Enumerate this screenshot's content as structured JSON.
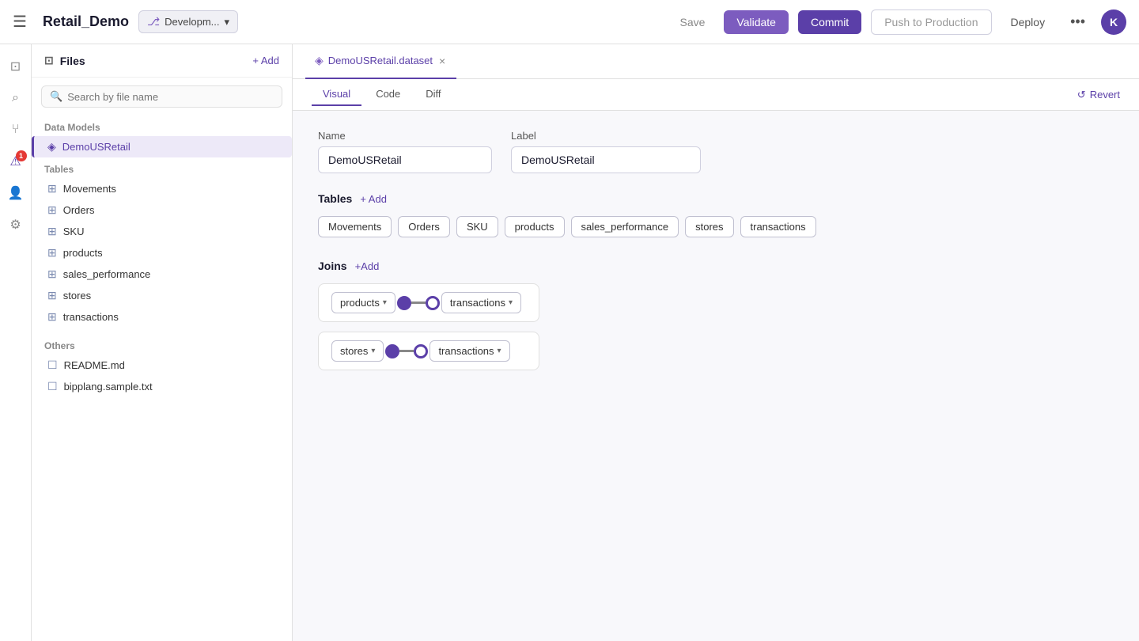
{
  "app": {
    "title": "Retail_Demo",
    "branch_icon": "⎇",
    "branch_label": "Developm...",
    "branch_dropdown": "▾"
  },
  "topbar": {
    "save_label": "Save",
    "validate_label": "Validate",
    "commit_label": "Commit",
    "push_label": "Push to Production",
    "deploy_label": "Deploy",
    "more_icon": "•••",
    "avatar_label": "K"
  },
  "icon_sidebar": {
    "icons": [
      {
        "id": "menu",
        "symbol": "☰",
        "active": false
      },
      {
        "id": "files",
        "symbol": "⊡",
        "active": false
      },
      {
        "id": "search",
        "symbol": "⌕",
        "active": false
      },
      {
        "id": "git",
        "symbol": "⑂",
        "active": false
      },
      {
        "id": "alert",
        "symbol": "⚠",
        "active": true,
        "badge": "1"
      },
      {
        "id": "user",
        "symbol": "👤",
        "active": false
      },
      {
        "id": "settings",
        "symbol": "⚙",
        "active": false
      }
    ]
  },
  "file_sidebar": {
    "header_label": "Files",
    "add_label": "+ Add",
    "search_placeholder": "Search by file name",
    "data_models_label": "Data Models",
    "demo_model": "DemoUSRetail",
    "tables_label": "Tables",
    "tables": [
      {
        "name": "Movements"
      },
      {
        "name": "Orders"
      },
      {
        "name": "SKU"
      },
      {
        "name": "products"
      },
      {
        "name": "sales_performance"
      },
      {
        "name": "stores"
      },
      {
        "name": "transactions"
      }
    ],
    "others_label": "Others",
    "others": [
      {
        "name": "README.md"
      },
      {
        "name": "bipplang.sample.txt"
      }
    ]
  },
  "tab_bar": {
    "tab_icon": "◈",
    "tab_label": "DemoUSRetail.dataset",
    "tab_close": "×"
  },
  "view_tabs": {
    "views": [
      "Visual",
      "Code",
      "Diff"
    ],
    "active": "Visual",
    "revert_label": "Revert",
    "revert_icon": "↺"
  },
  "dataset": {
    "name_label": "Name",
    "name_value": "DemoUSRetail",
    "label_label": "Label",
    "label_value": "DemoUSRetail",
    "tables_section_label": "Tables",
    "add_table_label": "+ Add",
    "tables": [
      "Movements",
      "Orders",
      "SKU",
      "products",
      "sales_performance",
      "stores",
      "transactions"
    ],
    "joins_section_label": "Joins",
    "add_join_label": "+Add",
    "joins": [
      {
        "left": "products",
        "right": "transactions"
      },
      {
        "left": "stores",
        "right": "transactions"
      }
    ]
  }
}
